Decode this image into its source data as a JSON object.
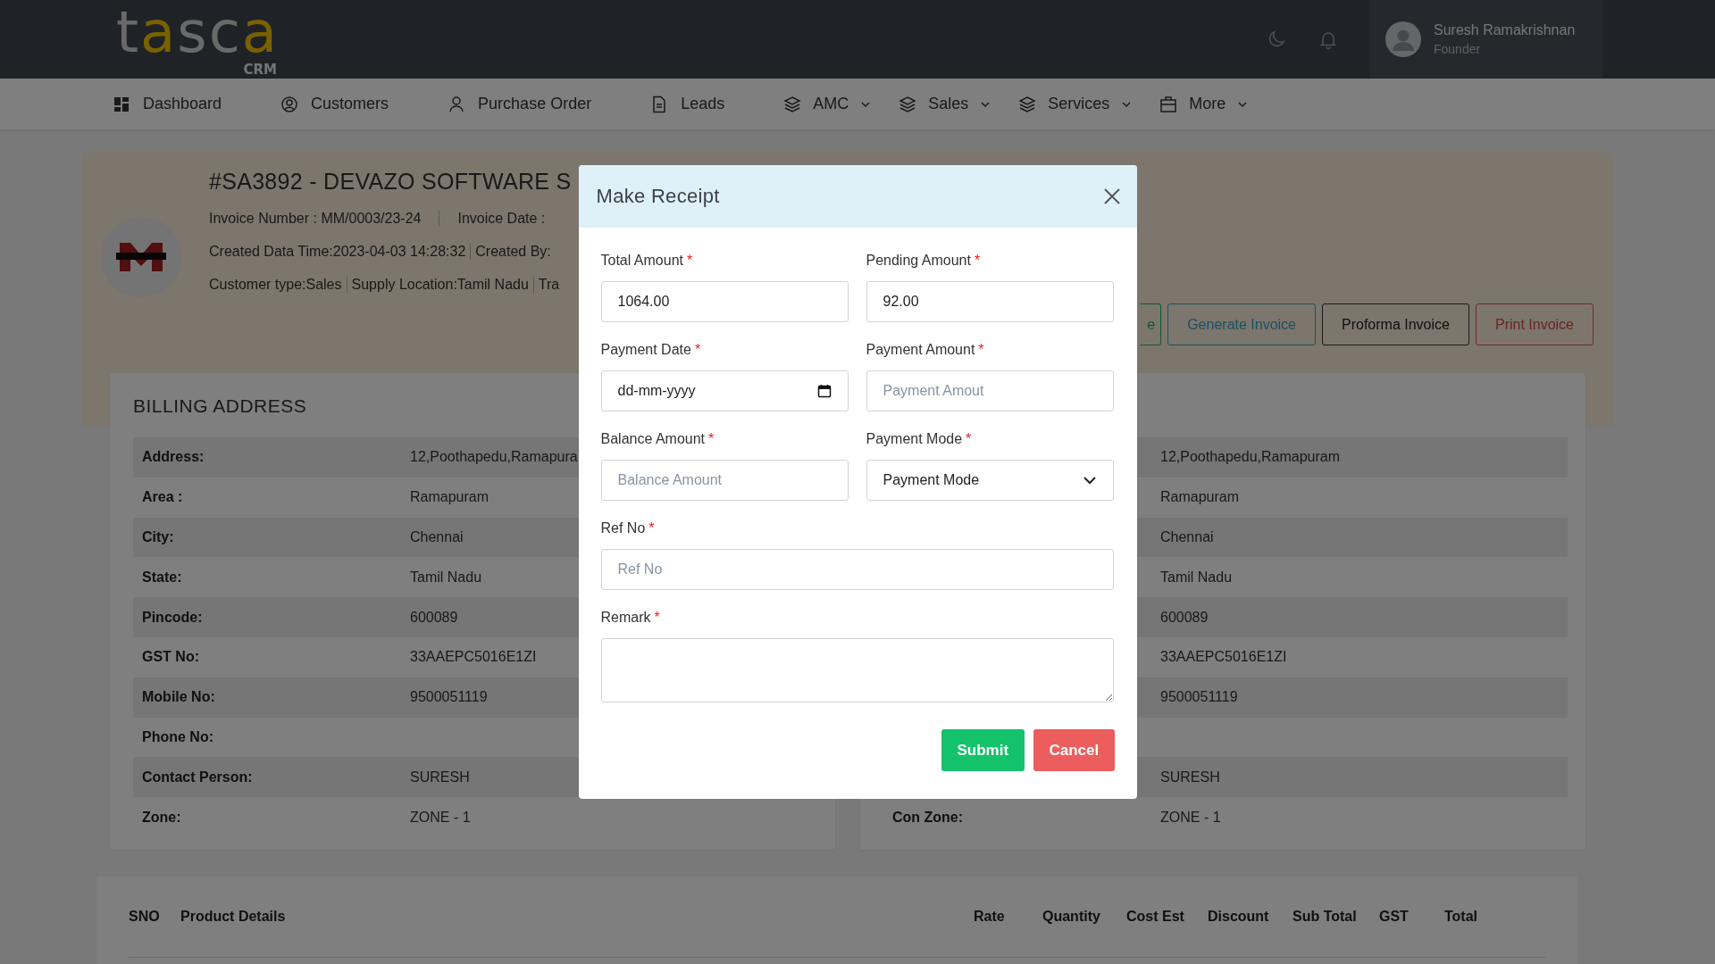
{
  "header": {
    "logo": {
      "parts": [
        {
          "text": "t",
          "accent": false
        },
        {
          "text": "a",
          "accent": true
        },
        {
          "text": "sc",
          "accent": false
        },
        {
          "text": "a",
          "accent": true
        }
      ],
      "sub": "CRM"
    },
    "user": {
      "name": "Suresh Ramakrishnan",
      "role": "Founder"
    }
  },
  "nav": [
    {
      "label": "Dashboard",
      "kind": "grid",
      "dropdown": false
    },
    {
      "label": "Customers",
      "kind": "account",
      "dropdown": false
    },
    {
      "label": "Purchase Order",
      "kind": "person",
      "dropdown": false
    },
    {
      "label": "Leads",
      "kind": "document",
      "dropdown": false
    },
    {
      "label": "AMC",
      "kind": "stack",
      "dropdown": true
    },
    {
      "label": "Sales",
      "kind": "stack",
      "dropdown": true
    },
    {
      "label": "Services",
      "kind": "stack",
      "dropdown": true
    },
    {
      "label": "More",
      "kind": "case",
      "dropdown": true
    }
  ],
  "invoice": {
    "title": "#SA3892 - DEVAZO SOFTWARE S",
    "meta": [
      [
        "Invoice Number : MM/0003/23-24",
        "Invoice Date :"
      ],
      [
        "Created Data Time:2023-04-03 14:28:32",
        "Created By:"
      ],
      [
        "Customer type:Sales",
        "Supply Location:Tamil Nadu",
        "Tra"
      ]
    ],
    "actions": [
      {
        "label": "e",
        "kind": "success"
      },
      {
        "label": "Generate Invoice",
        "kind": "info"
      },
      {
        "label": "Proforma Invoice",
        "kind": "dark"
      },
      {
        "label": "Print Invoice",
        "kind": "danger"
      }
    ]
  },
  "billing": {
    "title": "BILLING ADDRESS",
    "rows": [
      {
        "label": "Address:",
        "value": "12,Poothapedu,Ramapura"
      },
      {
        "label": "Area :",
        "value": "Ramapuram"
      },
      {
        "label": "City:",
        "value": "Chennai"
      },
      {
        "label": "State:",
        "value": "Tamil Nadu"
      },
      {
        "label": "Pincode:",
        "value": "600089"
      },
      {
        "label": "GST No:",
        "value": "33AAEPC5016E1ZI"
      },
      {
        "label": "Mobile No:",
        "value": "9500051119"
      },
      {
        "label": "Phone No:"
      },
      {
        "label": "Contact Person:",
        "value": "SURESH"
      },
      {
        "label": "Zone:",
        "value": "ZONE - 1"
      }
    ]
  },
  "shipping": {
    "rows": [
      {
        "value": "12,Poothapedu,Ramapuram"
      },
      {
        "value": "Ramapuram"
      },
      {
        "value": "Chennai"
      },
      {
        "value": "Tamil Nadu"
      },
      {
        "value": "600089"
      },
      {
        "value": "33AAEPC5016E1ZI"
      },
      {
        "value": "9500051119"
      },
      {},
      {
        "value": "SURESH"
      },
      {
        "label": "Con Zone:",
        "value": "ZONE - 1"
      }
    ]
  },
  "products_table": {
    "columns": [
      "SNO",
      "Product Details",
      "Rate",
      "Quantity",
      "Cost Est",
      "Discount",
      "Sub Total",
      "GST",
      "Total"
    ]
  },
  "modal": {
    "title": "Make Receipt",
    "fields": [
      {
        "label": "Total Amount",
        "mark": "*",
        "kind": "text",
        "value": "1064.00",
        "wide": false
      },
      {
        "label": "Pending Amount",
        "mark": "*",
        "kind": "text",
        "value": "92.00",
        "wide": false
      },
      {
        "label": "Payment Date",
        "mark": "*",
        "kind": "date",
        "value": "dd-mm-yyyy",
        "wide": false
      },
      {
        "label": "Payment Amount",
        "mark": "*",
        "kind": "text",
        "placeholder": "Payment Amout",
        "wide": false
      },
      {
        "label": "Balance Amount",
        "mark": "*",
        "kind": "text",
        "placeholder": "Balance Amount",
        "wide": false
      },
      {
        "label": "Payment Mode",
        "mark": "*",
        "kind": "select",
        "value": "Payment Mode",
        "wide": false
      },
      {
        "label": "Ref No",
        "mark": "*",
        "kind": "text",
        "placeholder": "Ref No",
        "wide": true
      },
      {
        "label": "Remark",
        "mark": "*",
        "kind": "textarea",
        "wide": true
      }
    ],
    "buttons": [
      {
        "label": "Submit",
        "kind": "primary"
      },
      {
        "label": "Cancel",
        "kind": "cancel"
      }
    ]
  }
}
